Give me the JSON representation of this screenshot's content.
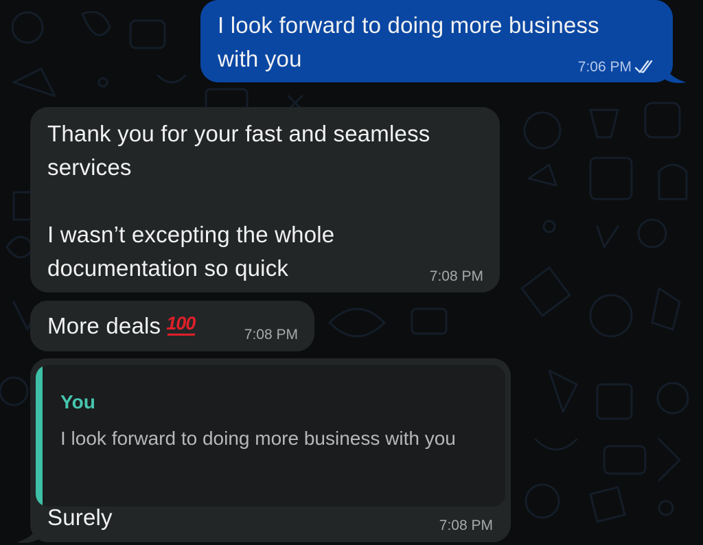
{
  "messages": {
    "outgoing": {
      "text": "I look forward to doing more business\nwith you",
      "time": "7:06 PM",
      "status_icon": "double-check-icon"
    },
    "incoming1": {
      "text": "Thank you for your fast and seamless\nservices\n\nI wasn’t excepting the whole\ndocumentation so quick",
      "time": "7:08 PM"
    },
    "incoming2": {
      "text": "More deals",
      "emoji": "100",
      "time": "7:08 PM"
    },
    "incoming3": {
      "quote_author": "You",
      "quote_text": "I look forward to doing more business with you",
      "text": "Surely",
      "time": "7:08 PM"
    }
  },
  "colors": {
    "outgoing_bubble": "#0a47a3",
    "incoming_bubble": "#232627",
    "quote_accent": "#3ec0a8",
    "background": "#0b0d0f"
  }
}
